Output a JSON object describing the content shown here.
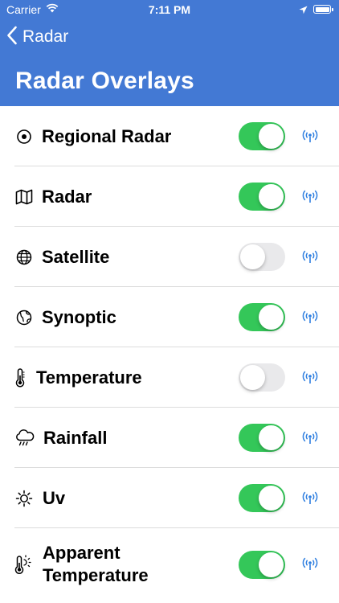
{
  "status_bar": {
    "carrier": "Carrier",
    "time": "7:11 PM"
  },
  "nav": {
    "back_label": "Radar",
    "title": "Radar Overlays"
  },
  "colors": {
    "header_bg": "#4379d4",
    "switch_on": "#34c759",
    "switch_off": "#e9e9eb",
    "accent": "#2f7fe0"
  },
  "overlays": [
    {
      "label": "Regional Radar",
      "icon": "target-icon",
      "enabled": true
    },
    {
      "label": "Radar",
      "icon": "map-icon",
      "enabled": true
    },
    {
      "label": "Satellite",
      "icon": "globe-icon",
      "enabled": false
    },
    {
      "label": "Synoptic",
      "icon": "globe-icon",
      "enabled": true
    },
    {
      "label": "Temperature",
      "icon": "thermometer-icon",
      "enabled": false
    },
    {
      "label": "Rainfall",
      "icon": "rain-cloud-icon",
      "enabled": true
    },
    {
      "label": "Uv",
      "icon": "sun-icon",
      "enabled": true
    },
    {
      "label": "Apparent Temperature",
      "icon": "thermometer-sun-icon",
      "enabled": true
    }
  ]
}
